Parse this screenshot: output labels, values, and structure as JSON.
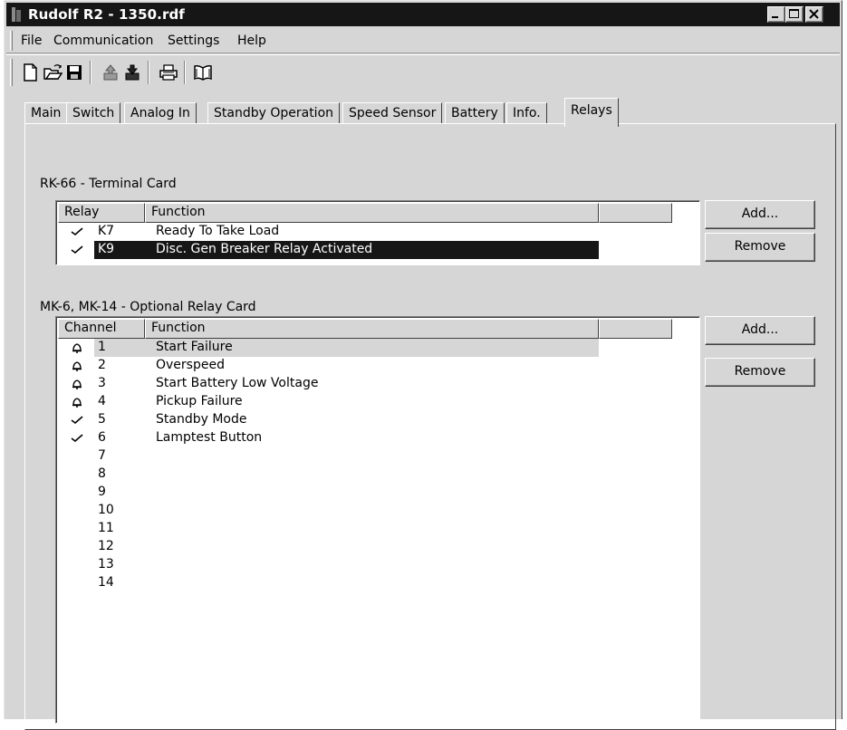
{
  "window": {
    "title": "Rudolf R2 - 1350.rdf"
  },
  "menu": [
    "File",
    "Communication",
    "Settings",
    "Help"
  ],
  "toolbar_icons": [
    "new-icon",
    "open-icon",
    "save-icon",
    "upload-icon",
    "download-icon",
    "print-icon",
    "help-book-icon"
  ],
  "tabs": [
    "Main",
    "Switch",
    "Analog In",
    "Standby Operation",
    "Speed Sensor",
    "Battery",
    "Info.",
    "Relays"
  ],
  "active_tab": "Relays",
  "terminal_card": {
    "label": "RK-66 - Terminal Card",
    "columns": [
      "Relay",
      "Function",
      ""
    ],
    "rows": [
      {
        "id": "K7",
        "function": "Ready To Take Load",
        "icon": "check-icon"
      },
      {
        "id": "K9",
        "function": "Disc. Gen Breaker Relay Activated",
        "icon": "check-icon"
      }
    ],
    "add_label": "Add...",
    "remove_label": "Remove"
  },
  "relay_card": {
    "label": "MK-6, MK-14 - Optional Relay Card",
    "columns": [
      "Channel",
      "Function",
      ""
    ],
    "rows": [
      {
        "id": "1",
        "function": "Start Failure",
        "icon": "bell-icon"
      },
      {
        "id": "2",
        "function": "Overspeed",
        "icon": "bell-icon"
      },
      {
        "id": "3",
        "function": "Start Battery Low Voltage",
        "icon": "bell-icon"
      },
      {
        "id": "4",
        "function": "Pickup Failure",
        "icon": "bell-icon"
      },
      {
        "id": "5",
        "function": "Standby Mode",
        "icon": "check-icon"
      },
      {
        "id": "6",
        "function": "Lamptest Button",
        "icon": "check-icon"
      },
      {
        "id": "7",
        "function": "",
        "icon": ""
      },
      {
        "id": "8",
        "function": "",
        "icon": ""
      },
      {
        "id": "9",
        "function": "",
        "icon": ""
      },
      {
        "id": "10",
        "function": "",
        "icon": ""
      },
      {
        "id": "11",
        "function": "",
        "icon": ""
      },
      {
        "id": "12",
        "function": "",
        "icon": ""
      },
      {
        "id": "13",
        "function": "",
        "icon": ""
      },
      {
        "id": "14",
        "function": "",
        "icon": ""
      }
    ],
    "add_label": "Add...",
    "remove_label": "Remove"
  },
  "colors": {
    "face": "#d6d6d6",
    "title_bar": "#161616",
    "selection": "#161616"
  }
}
